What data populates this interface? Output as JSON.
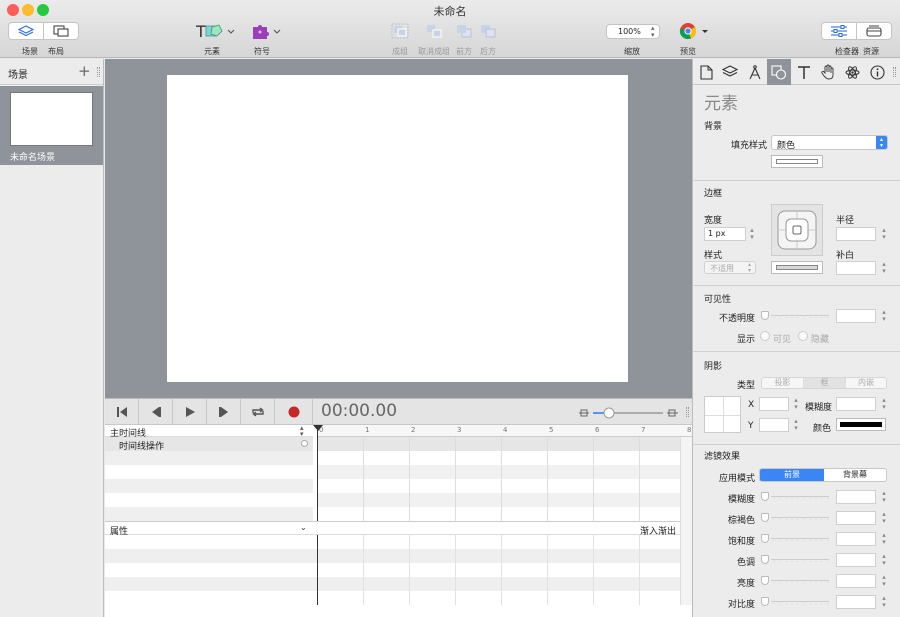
{
  "window": {
    "title": "未命名"
  },
  "toolbar": {
    "scenes_label": "场景",
    "layout_label": "布局",
    "elements_label": "元素",
    "symbols_label": "符号",
    "group_label": "成组",
    "ungroup_label": "取消成组",
    "front_label": "前方",
    "back_label": "后方",
    "zoom_value": "100%",
    "zoom_label": "缩放",
    "preview_label": "预览",
    "inspector_label": "检查器",
    "resources_label": "资源"
  },
  "scenes": {
    "header": "场景",
    "add_icon": "+",
    "items": [
      {
        "name": "未命名场景"
      }
    ]
  },
  "timeline": {
    "timecode": "00:00.00",
    "main_timeline": "主时间线",
    "timeline_actions": "时间线操作",
    "properties": "属性",
    "easing": "渐入渐出",
    "ruler": [
      "0",
      "1",
      "2",
      "3",
      "4",
      "5",
      "6",
      "7",
      "8"
    ]
  },
  "inspector": {
    "title": "元素",
    "background": {
      "section": "背景",
      "fill_style_label": "填充样式",
      "fill_style_value": "颜色"
    },
    "border": {
      "section": "边框",
      "width_label": "宽度",
      "width_value": "1 px",
      "radius_label": "半径",
      "style_label": "样式",
      "style_value": "不适用",
      "padding_label": "补白"
    },
    "visibility": {
      "section": "可见性",
      "opacity_label": "不透明度",
      "display_label": "显示",
      "visible_option": "可见",
      "hidden_option": "隐藏"
    },
    "shadow": {
      "section": "阴影",
      "type_label": "类型",
      "types": [
        "投影",
        "框",
        "内嵌"
      ],
      "x_label": "X",
      "y_label": "Y",
      "blur_label": "模糊度",
      "color_label": "颜色",
      "color_value": "#000000"
    },
    "filters": {
      "section": "滤镜效果",
      "apply_mode_label": "应用模式",
      "modes": [
        "前景",
        "背景幕"
      ],
      "items": [
        "模糊度",
        "棕褐色",
        "饱和度",
        "色调",
        "亮度",
        "对比度"
      ]
    }
  },
  "colors": {
    "accent": "#3b86f7",
    "record": "#c62828",
    "close": "#fc5f57",
    "minimize": "#fdbc2e",
    "maximize": "#28c940"
  }
}
